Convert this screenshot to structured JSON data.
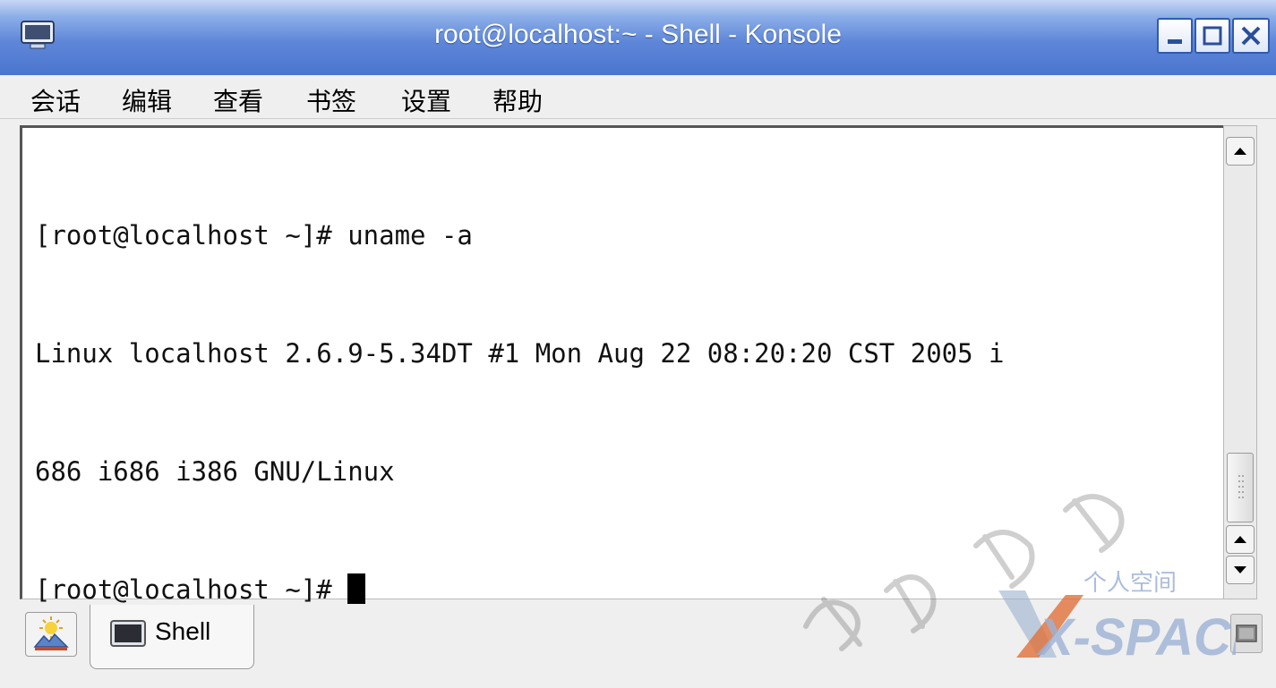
{
  "window": {
    "title": "root@localhost:~ - Shell - Konsole",
    "icon": "konsole-monitor-icon",
    "buttons": [
      "minimize-icon",
      "maximize-icon",
      "close-icon"
    ]
  },
  "menu": {
    "items": [
      "会话",
      "编辑",
      "查看",
      "书签",
      "设置",
      "帮助"
    ]
  },
  "terminal": {
    "lines": [
      "[root@localhost ~]# uname -a",
      "Linux localhost 2.6.9-5.34DT #1 Mon Aug 22 08:20:20 CST 2005 i",
      "686 i686 i386 GNU/Linux",
      "[root@localhost ~]# "
    ],
    "background": "#ffffff",
    "foreground": "#111111"
  },
  "tabs": {
    "items": [
      {
        "label": "Shell",
        "icon": "terminal-icon"
      }
    ],
    "new_session_icon": "new-session-icon",
    "close_session_icon": "close-session-icon"
  },
  "watermark": {
    "brand": "X-SPACE",
    "subtitle": "个人空间"
  },
  "colors": {
    "titlebar": "#5f87d8",
    "menubar": "#efefef"
  }
}
